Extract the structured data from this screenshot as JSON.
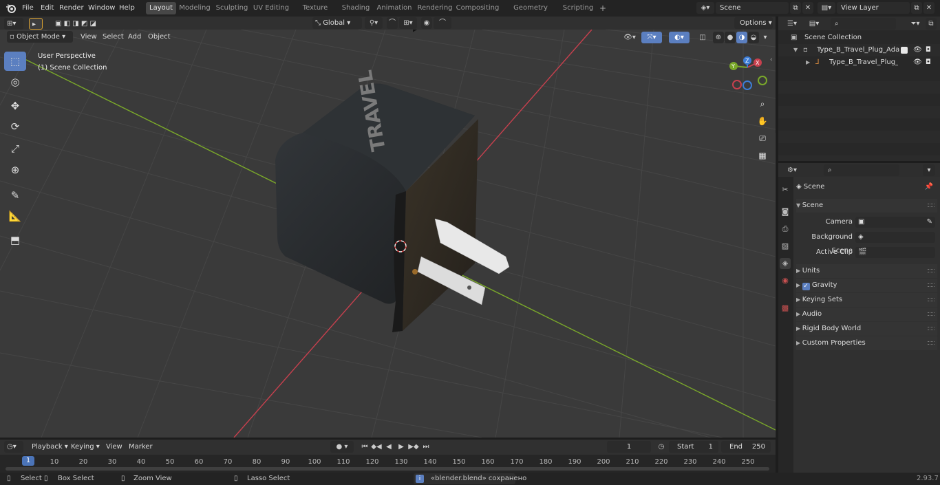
{
  "topbar": {
    "menus": [
      "File",
      "Edit",
      "Render",
      "Window",
      "Help"
    ],
    "workspaces": [
      "Layout",
      "Modeling",
      "Sculpting",
      "UV Editing",
      "Texture Paint",
      "Shading",
      "Animation",
      "Rendering",
      "Compositing",
      "Geometry Nodes",
      "Scripting"
    ],
    "add_tab": "+",
    "scene_name": "Scene",
    "view_layer_name": "View Layer"
  },
  "viewport_header": {
    "mode": "Object Mode",
    "menus": [
      "View",
      "Select",
      "Add",
      "Object"
    ],
    "transform_orientation": "Global",
    "options": "Options"
  },
  "viewport": {
    "perspective_label": "User Perspective",
    "collection_label": "(1) Scene Collection",
    "gizmo_axes": [
      "X",
      "Y",
      "Z"
    ],
    "model_logo_text": "TRAVEL"
  },
  "outliner": {
    "search_placeholder": "",
    "scene_collection": "Scene Collection",
    "items": [
      {
        "name": "Type_B_Travel_Plug_Adapter"
      },
      {
        "name": "Type_B_Travel_Plug_Ada"
      }
    ]
  },
  "properties": {
    "context": "Scene",
    "section": "Scene",
    "fields": [
      {
        "label": "Camera",
        "value": ""
      },
      {
        "label": "Background Scene",
        "value": ""
      },
      {
        "label": "Active Clip",
        "value": ""
      }
    ],
    "subpanels": [
      "Units",
      "Gravity",
      "Keying Sets",
      "Audio",
      "Rigid Body World",
      "Custom Properties"
    ],
    "gravity_checked": true
  },
  "timeline": {
    "menus": [
      "Playback",
      "Keying",
      "View",
      "Marker"
    ],
    "current_frame": "1",
    "start_label": "Start",
    "start_value": "1",
    "end_label": "End",
    "end_value": "250",
    "ticks": [
      "1",
      "10",
      "20",
      "30",
      "40",
      "50",
      "60",
      "70",
      "80",
      "90",
      "100",
      "110",
      "120",
      "130",
      "140",
      "150",
      "160",
      "170",
      "180",
      "190",
      "200",
      "210",
      "220",
      "230",
      "240",
      "250"
    ]
  },
  "statusbar": {
    "select": "Select",
    "box_select": "Box Select",
    "zoom_view": "Zoom View",
    "lasso_select": "Lasso Select",
    "message": "«blender.blend» сохранено",
    "version": "2.93.7"
  },
  "colors": {
    "accent": "#5b7fc0",
    "x_axis": "#c8404e",
    "y_axis": "#7aa82a",
    "z_axis": "#3d7dd6",
    "viewport_bg": "#3a3a3a"
  }
}
